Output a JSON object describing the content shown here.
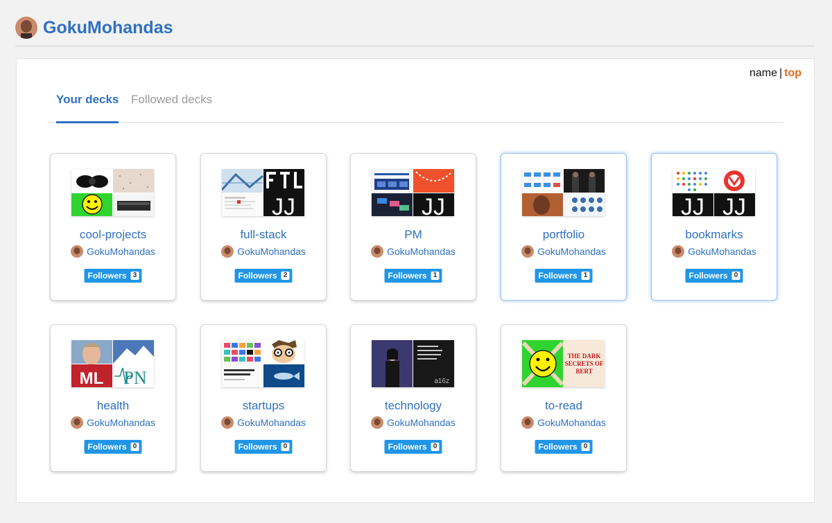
{
  "header": {
    "username": "GokuMohandas"
  },
  "tabs": [
    {
      "label": "Your decks",
      "active": true
    },
    {
      "label": "Followed decks",
      "active": false
    }
  ],
  "sort": {
    "name_label": "name",
    "separator": "|",
    "top_label": "top"
  },
  "followers_label": "Followers",
  "colors": {
    "accent": "#2f70c1",
    "badge": "#2196e6",
    "sort_active": "#e26a1b"
  },
  "decks": [
    {
      "title": "cool-projects",
      "owner": "GokuMohandas",
      "followers": "3",
      "highlighted": false
    },
    {
      "title": "full-stack",
      "owner": "GokuMohandas",
      "followers": "2",
      "highlighted": false
    },
    {
      "title": "PM",
      "owner": "GokuMohandas",
      "followers": "1",
      "highlighted": false
    },
    {
      "title": "portfolio",
      "owner": "GokuMohandas",
      "followers": "1",
      "highlighted": true
    },
    {
      "title": "bookmarks",
      "owner": "GokuMohandas",
      "followers": "0",
      "highlighted": true
    },
    {
      "title": "health",
      "owner": "GokuMohandas",
      "followers": "0",
      "highlighted": false
    },
    {
      "title": "startups",
      "owner": "GokuMohandas",
      "followers": "0",
      "highlighted": false
    },
    {
      "title": "technology",
      "owner": "GokuMohandas",
      "followers": "0",
      "highlighted": false
    },
    {
      "title": "to-read",
      "owner": "GokuMohandas",
      "followers": "0",
      "highlighted": false
    }
  ],
  "thumb_text": {
    "full_stack": "JJ",
    "pm": "JJ",
    "bookmarks_left": "JJ",
    "bookmarks_right": "JJ",
    "health_ml": "ML",
    "health_pn": "PN",
    "technology": "a16z",
    "to_read": "THE DARK SECRETS OF BERT"
  }
}
